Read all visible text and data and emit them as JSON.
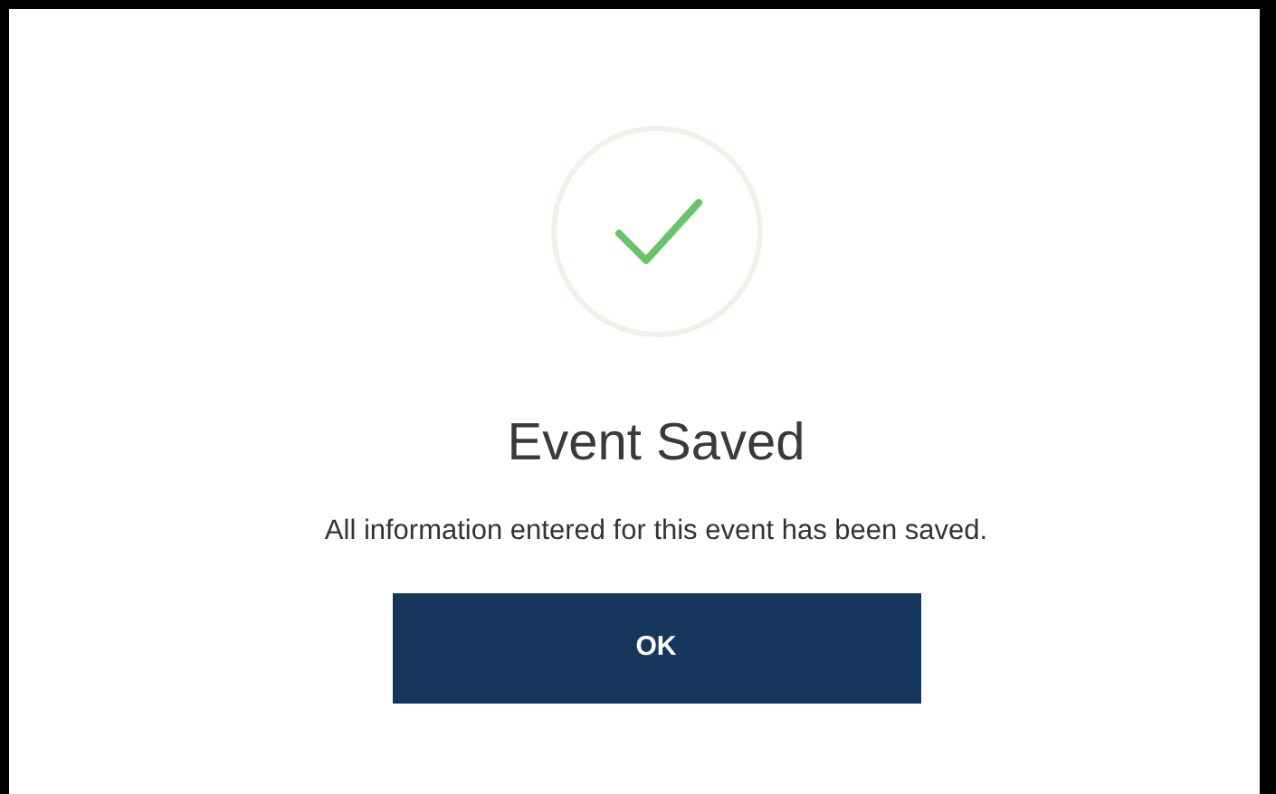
{
  "dialog": {
    "title": "Event Saved",
    "message": "All information entered for this event has been saved.",
    "buttons": [
      {
        "label": "OK"
      }
    ]
  }
}
